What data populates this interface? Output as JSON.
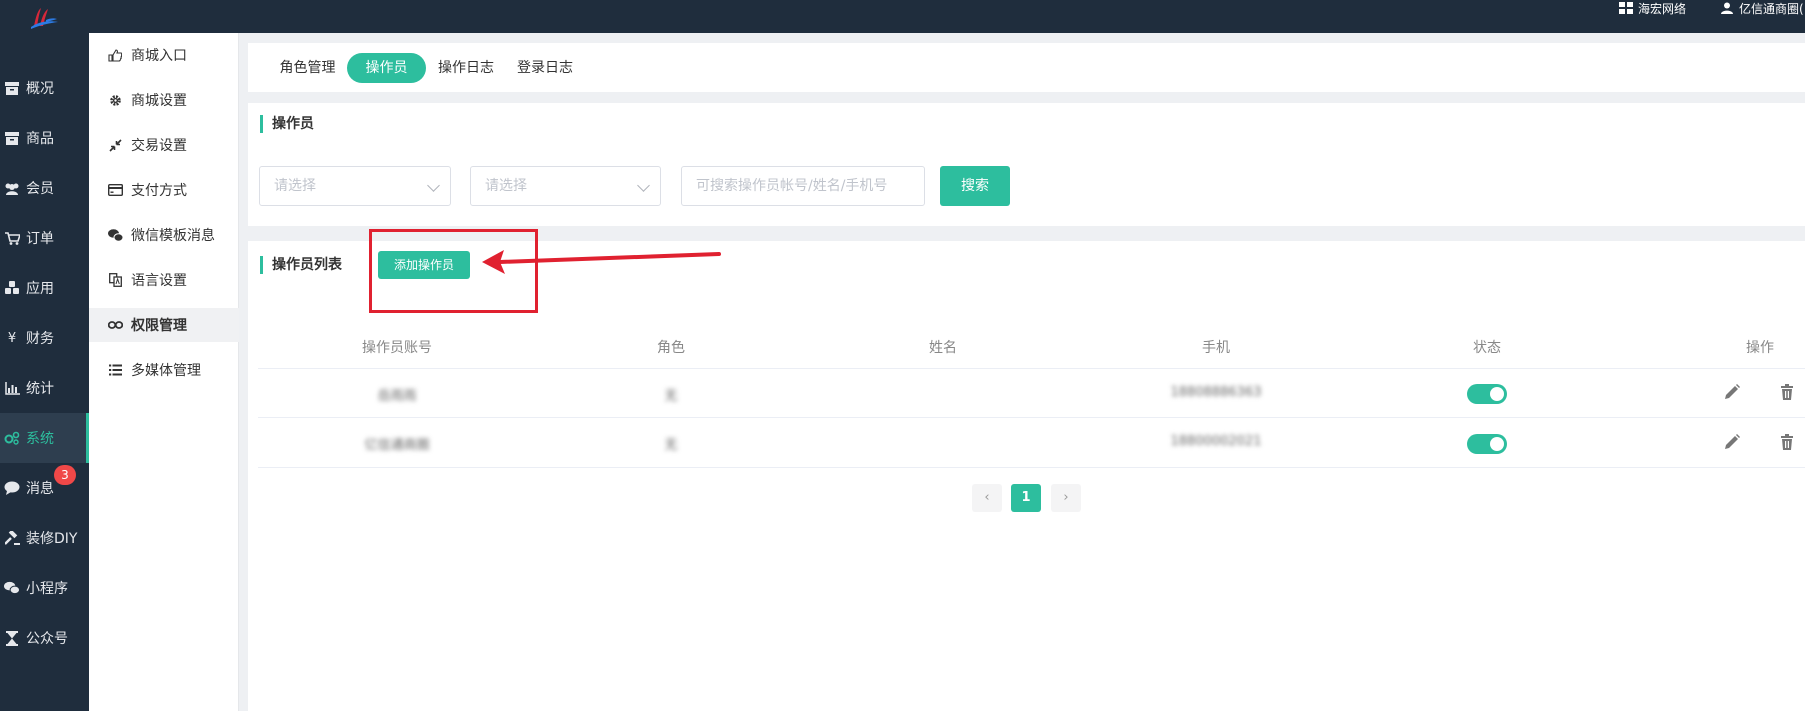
{
  "header": {
    "org_name": "海宏网络",
    "user_name": "亿信通商圈("
  },
  "leftnav": {
    "items": [
      {
        "label": "概况",
        "icon": "archive-icon"
      },
      {
        "label": "商品",
        "icon": "archive-icon"
      },
      {
        "label": "会员",
        "icon": "users-icon"
      },
      {
        "label": "订单",
        "icon": "cart-icon"
      },
      {
        "label": "应用",
        "icon": "cubes-icon"
      },
      {
        "label": "财务",
        "icon": "yen-icon"
      },
      {
        "label": "统计",
        "icon": "bar-chart-icon"
      },
      {
        "label": "系统",
        "icon": "gears-icon"
      },
      {
        "label": "消息",
        "icon": "comment-icon"
      },
      {
        "label": "装修DIY",
        "icon": "gavel-icon"
      },
      {
        "label": "小程序",
        "icon": "wechat-icon"
      },
      {
        "label": "公众号",
        "icon": "hourglass-icon"
      }
    ],
    "active_index": 7,
    "message_badge": "3"
  },
  "subnav": {
    "items": [
      {
        "label": "商城入口",
        "icon": "hand-point-icon"
      },
      {
        "label": "商城设置",
        "icon": "gear-icon"
      },
      {
        "label": "交易设置",
        "icon": "compress-icon"
      },
      {
        "label": "支付方式",
        "icon": "credit-card-icon"
      },
      {
        "label": "微信模板消息",
        "icon": "wechat-icon"
      },
      {
        "label": "语言设置",
        "icon": "translate-icon"
      },
      {
        "label": "权限管理",
        "icon": "glasses-icon"
      },
      {
        "label": "多媒体管理",
        "icon": "list-icon"
      }
    ],
    "active_index": 6
  },
  "tabs": [
    {
      "label": "角色管理"
    },
    {
      "label": "操作员"
    },
    {
      "label": "操作日志"
    },
    {
      "label": "登录日志"
    }
  ],
  "tabs_active_index": 1,
  "filter": {
    "section_title": "操作员",
    "select1_placeholder": "请选择",
    "select2_placeholder": "请选择",
    "search_placeholder": "可搜索操作员帐号/姓名/手机号",
    "search_button": "搜索"
  },
  "list": {
    "section_title": "操作员列表",
    "add_button": "添加操作员",
    "columns": [
      "操作员账号",
      "角色",
      "姓名",
      "手机",
      "状态",
      "操作"
    ],
    "rows": [
      {
        "account": "岳雨雨",
        "role": "无",
        "name": "",
        "phone": "18808886363",
        "status_on": true
      },
      {
        "account": "亿信通商圈",
        "role": "无",
        "name": "",
        "phone": "18800002021",
        "status_on": true
      }
    ]
  },
  "pager": {
    "prev": "‹",
    "current": "1",
    "next": "›"
  },
  "colors": {
    "accent": "#2dbe9e",
    "nav_bg": "#1f2d3d",
    "annotation": "#e02130",
    "badge": "#f04848"
  }
}
